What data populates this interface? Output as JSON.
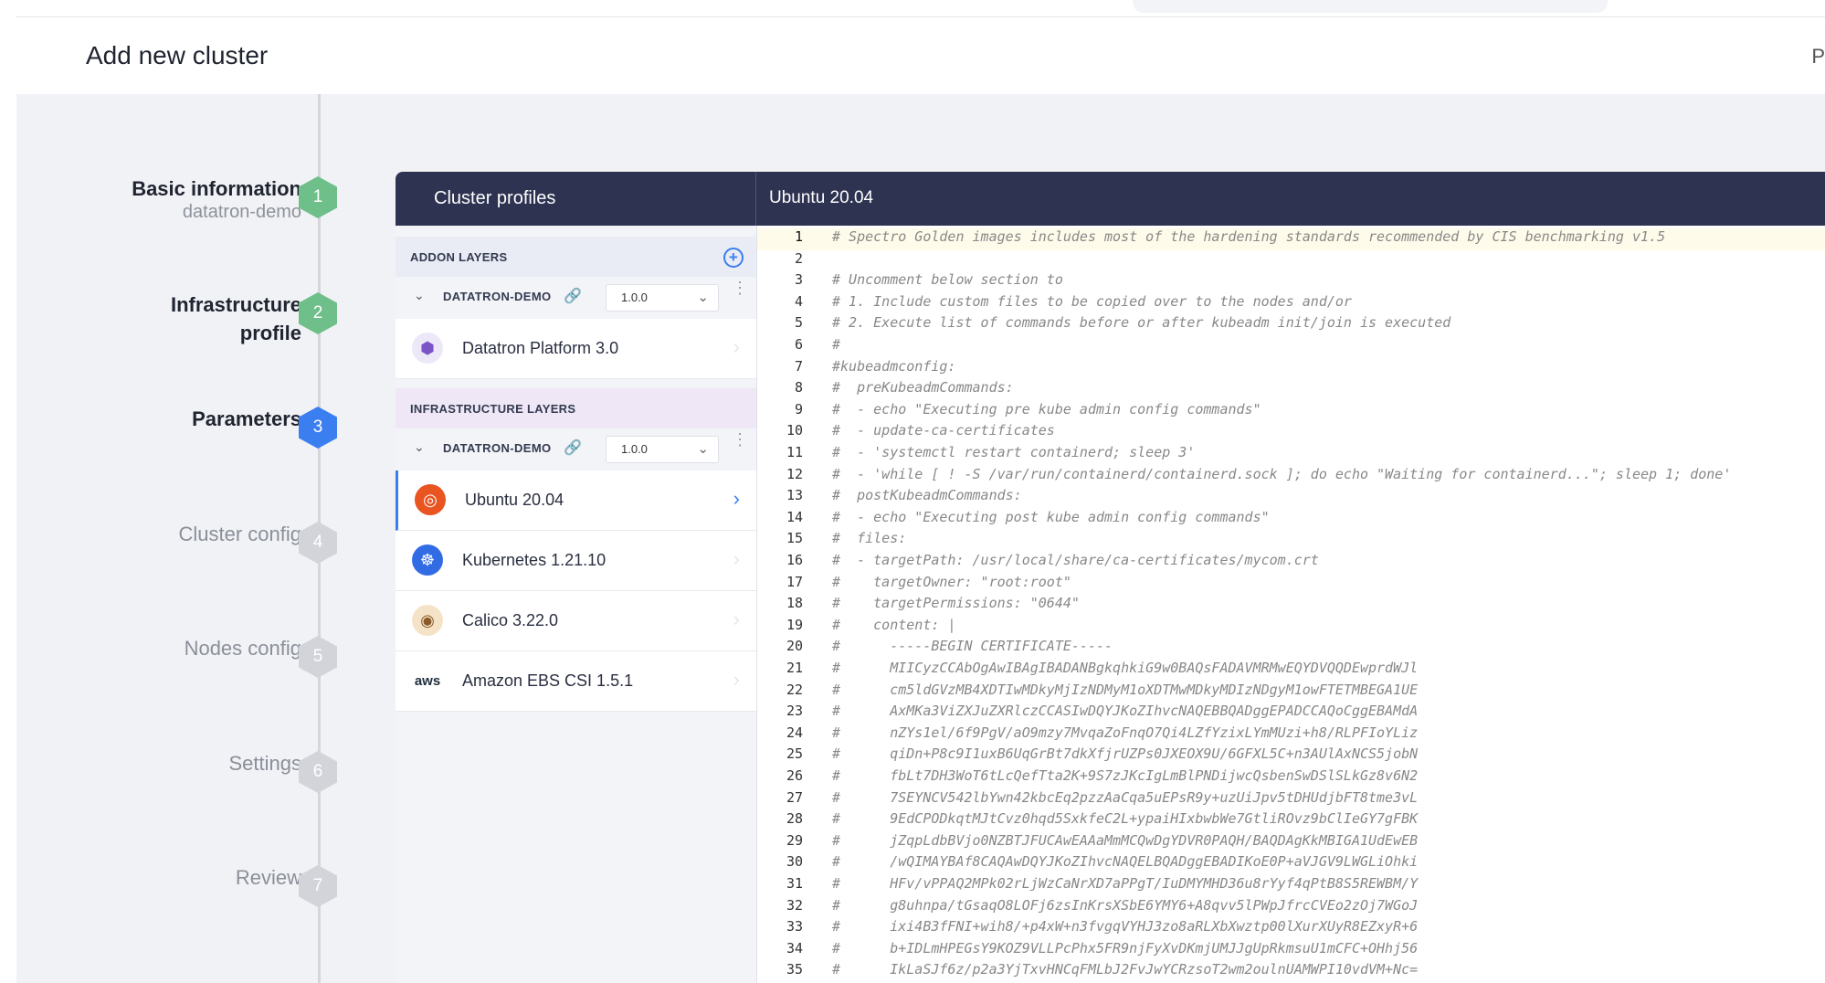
{
  "header": {
    "title": "Add new cluster",
    "right_cut": "P"
  },
  "steps": [
    {
      "title": "Basic information",
      "subtitle": "datatron-demo",
      "num": "1",
      "state": "done"
    },
    {
      "title": "Infrastructure\nprofile",
      "num": "2",
      "state": "done"
    },
    {
      "title": "Parameters",
      "num": "3",
      "state": "active"
    },
    {
      "title": "Cluster config",
      "num": "4",
      "state": "todo"
    },
    {
      "title": "Nodes config",
      "num": "5",
      "state": "todo"
    },
    {
      "title": "Settings",
      "num": "6",
      "state": "todo"
    },
    {
      "title": "Review",
      "num": "7",
      "state": "todo"
    }
  ],
  "panel": {
    "left_title": "Cluster profiles",
    "right_title": "Ubuntu 20.04",
    "addon_header": "ADDON LAYERS",
    "infra_header": "INFRASTRUCTURE LAYERS",
    "addon_profile": {
      "name": "DATATRON-DEMO",
      "version": "1.0.0"
    },
    "infra_profile": {
      "name": "DATATRON-DEMO",
      "version": "1.0.0"
    },
    "addon_layers": [
      {
        "name": "Datatron Platform 3.0",
        "icon": "datatron-icon"
      }
    ],
    "infra_layers": [
      {
        "name": "Ubuntu 20.04",
        "icon": "ubuntu-icon",
        "selected": true
      },
      {
        "name": "Kubernetes 1.21.10",
        "icon": "kubernetes-icon"
      },
      {
        "name": "Calico 3.22.0",
        "icon": "calico-icon"
      },
      {
        "name": "Amazon EBS CSI 1.5.1",
        "icon": "aws-icon"
      }
    ]
  },
  "editor": {
    "lines": [
      "# Spectro Golden images includes most of the hardening standards recommended by CIS benchmarking v1.5",
      "",
      "# Uncomment below section to",
      "# 1. Include custom files to be copied over to the nodes and/or",
      "# 2. Execute list of commands before or after kubeadm init/join is executed",
      "#",
      "#kubeadmconfig:",
      "#  preKubeadmCommands:",
      "#  - echo \"Executing pre kube admin config commands\"",
      "#  - update-ca-certificates",
      "#  - 'systemctl restart containerd; sleep 3'",
      "#  - 'while [ ! -S /var/run/containerd/containerd.sock ]; do echo \"Waiting for containerd...\"; sleep 1; done'",
      "#  postKubeadmCommands:",
      "#  - echo \"Executing post kube admin config commands\"",
      "#  files:",
      "#  - targetPath: /usr/local/share/ca-certificates/mycom.crt",
      "#    targetOwner: \"root:root\"",
      "#    targetPermissions: \"0644\"",
      "#    content: |",
      "#      -----BEGIN CERTIFICATE-----",
      "#      MIICyzCCAbOgAwIBAgIBADANBgkqhkiG9w0BAQsFADAVMRMwEQYDVQQDEwprdWJl",
      "#      cm5ldGVzMB4XDTIwMDkyMjIzNDMyM1oXDTMwMDkyMDIzNDgyM1owFTETMBEGA1UE",
      "#      AxMKa3ViZXJuZXRlczCCASIwDQYJKoZIhvcNAQEBBQADggEPADCCAQoCggEBAMdA",
      "#      nZYs1el/6f9PgV/aO9mzy7MvqaZoFnqO7Qi4LZfYzixLYmMUzi+h8/RLPFIoYLiz",
      "#      qiDn+P8c9I1uxB6UqGrBt7dkXfjrUZPs0JXEOX9U/6GFXL5C+n3AUlAxNCS5jobN",
      "#      fbLt7DH3WoT6tLcQefTta2K+9S7zJKcIgLmBlPNDijwcQsbenSwDSlSLkGz8v6N2",
      "#      7SEYNCV542lbYwn42kbcEq2pzzAaCqa5uEPsR9y+uzUiJpv5tDHUdjbFT8tme3vL",
      "#      9EdCPODkqtMJtCvz0hqd5SxkfeC2L+ypaiHIxbwbWe7GtliROvz9bClIeGY7gFBK",
      "#      jZqpLdbBVjo0NZBTJFUCAwEAAaMmMCQwDgYDVR0PAQH/BAQDAgKkMBIGA1UdEwEB",
      "#      /wQIMAYBAf8CAQAwDQYJKoZIhvcNAQELBQADggEBADIKoE0P+aVJGV9LWGLiOhki",
      "#      HFv/vPPAQ2MPk02rLjWzCaNrXD7aPPgT/IuDMYMHD36u8rYyf4qPtB8S5REWBM/Y",
      "#      g8uhnpa/tGsaqO8LOFj6zsInKrsXSbE6YMY6+A8qvv5lPWpJfrcCVEo2zOj7WGoJ",
      "#      ixi4B3fFNI+wih8/+p4xW+n3fvgqVYHJ3zo8aRLXbXwztp00lXurXUyR8EZxyR+6",
      "#      b+IDLmHPEGsY9KOZ9VLLPcPhx5FR9njFyXvDKmjUMJJgUpRkmsuU1mCFC+OHhj56",
      "#      IkLaSJf6z/p2a3YjTxvHNCqFMLbJ2FvJwYCRzsoT2wm2oulnUAMWPI10vdVM+Nc="
    ]
  }
}
